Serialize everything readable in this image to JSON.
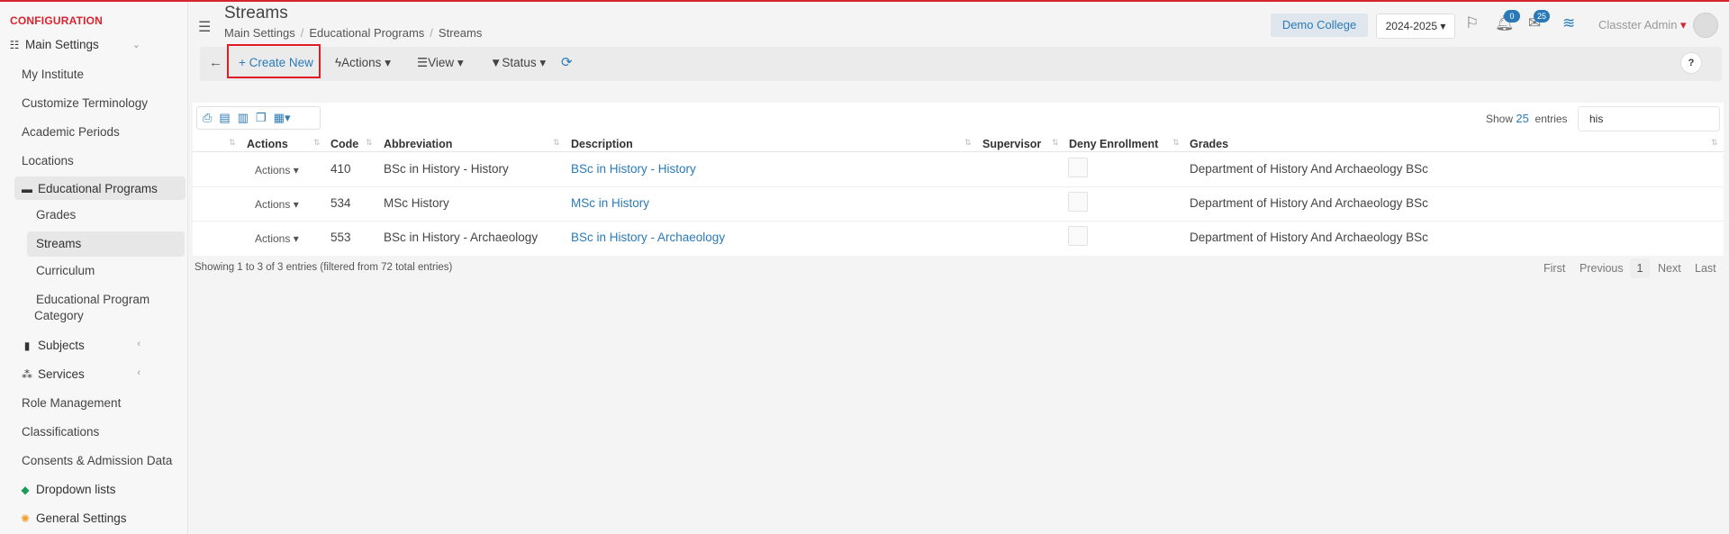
{
  "sidebar": {
    "title": "CONFIGURATION",
    "main_settings": "Main Settings",
    "items": [
      "My Institute",
      "Customize Terminology",
      "Academic Periods",
      "Locations"
    ],
    "edu_programs": "Educational Programs",
    "edu_children": [
      "Grades",
      "Streams",
      "Curriculum"
    ],
    "edu_category_line1": "Educational Program",
    "edu_category_line2": "Category",
    "subjects": "Subjects",
    "services": "Services",
    "role_management": "Role Management",
    "classifications": "Classifications",
    "consents": "Consents & Admission Data",
    "dropdown_lists": "Dropdown lists",
    "general_settings": "General Settings"
  },
  "header": {
    "title": "Streams",
    "breadcrumb": [
      "Main Settings",
      "Educational Programs",
      "Streams"
    ],
    "college": "Demo College",
    "year": "2024-2025",
    "notif_count": "0",
    "msg_count": "25",
    "user": "Classter Admin"
  },
  "toolbar": {
    "create": "Create New",
    "actions": "Actions",
    "view": "View",
    "status": "Status",
    "help": "?"
  },
  "table": {
    "show_label": "Show",
    "show_count": "25",
    "entries_label": "entries",
    "search_value": "his",
    "columns": [
      "Actions",
      "Code",
      "Abbreviation",
      "Description",
      "Supervisor",
      "Deny Enrollment",
      "Grades"
    ],
    "rows": [
      {
        "actions": "Actions",
        "code": "410",
        "abbreviation": "BSc in History - History",
        "description": "BSc in History - History",
        "supervisor": "",
        "grades": "Department of History And Archaeology BSc"
      },
      {
        "actions": "Actions",
        "code": "534",
        "abbreviation": "MSc History",
        "description": "MSc in History",
        "supervisor": "",
        "grades": "Department of History And Archaeology BSc"
      },
      {
        "actions": "Actions",
        "code": "553",
        "abbreviation": "BSc in History - Archaeology",
        "description": "BSc in History - Archaeology",
        "supervisor": "",
        "grades": "Department of History And Archaeology BSc"
      }
    ],
    "info": "Showing 1 to 3 of 3 entries (filtered from 72 total entries)",
    "pagination": {
      "first": "First",
      "previous": "Previous",
      "current": "1",
      "next": "Next",
      "last": "Last"
    }
  },
  "colors": {
    "accent": "#2a7ab8",
    "brand_red": "#d9232d"
  }
}
